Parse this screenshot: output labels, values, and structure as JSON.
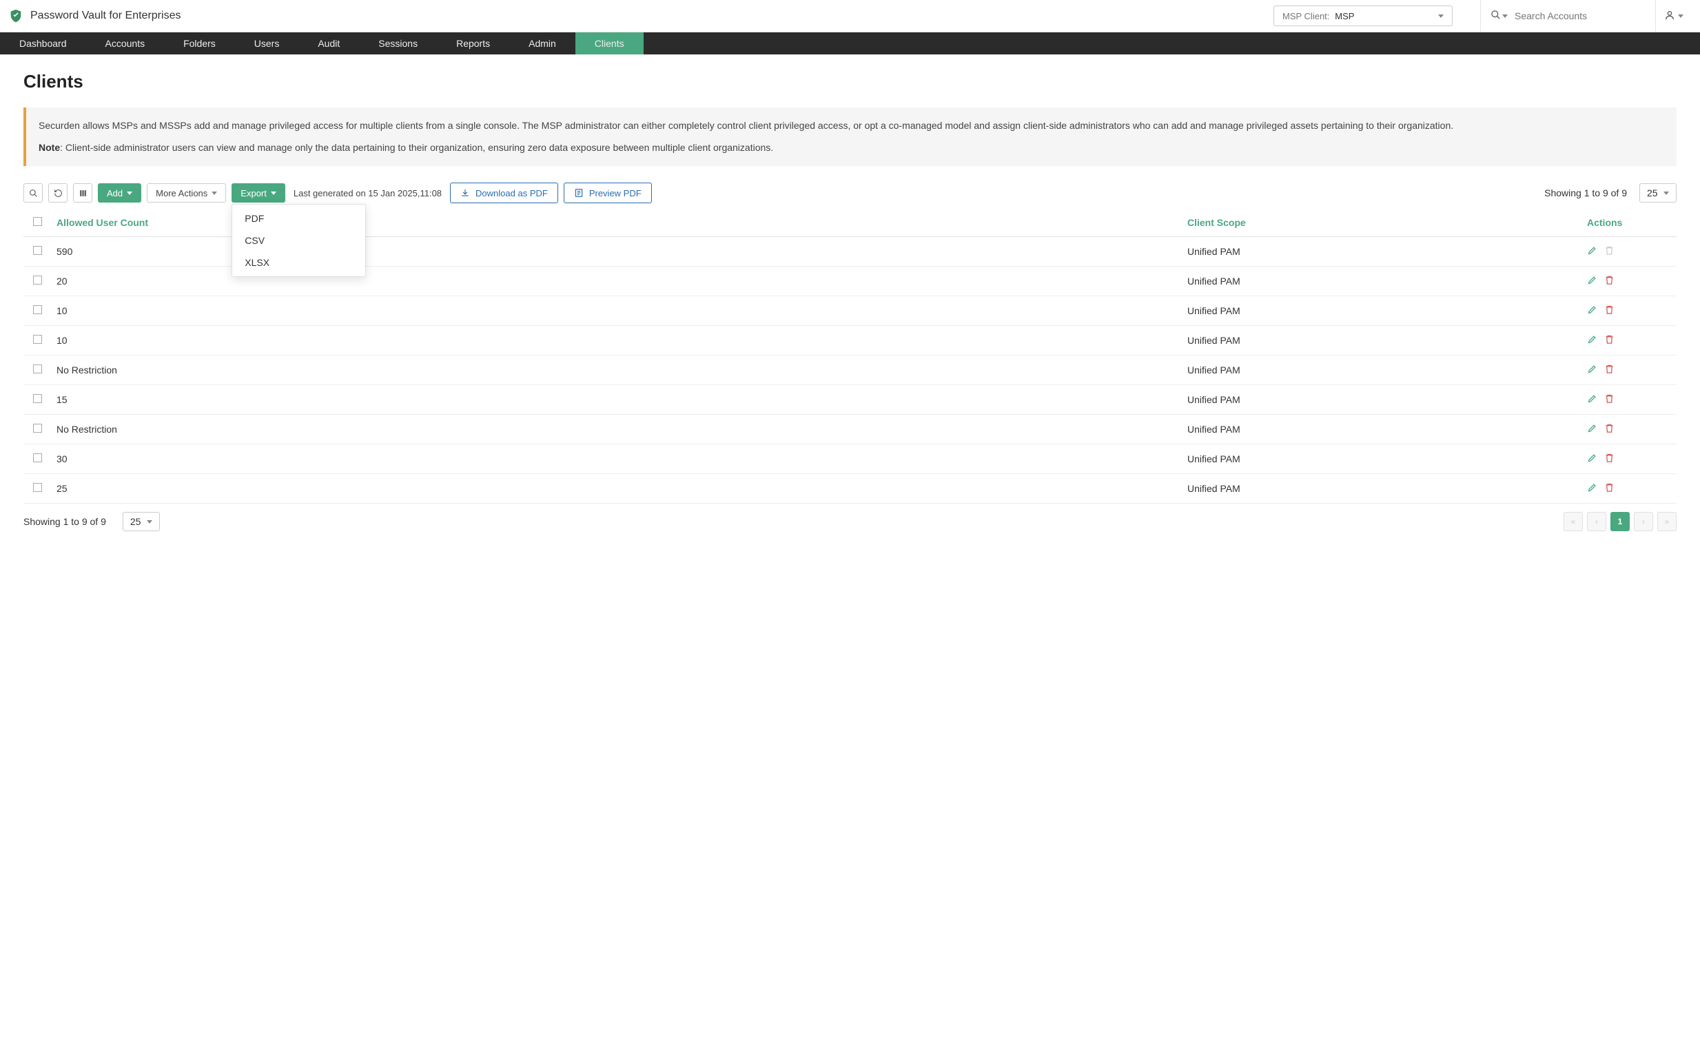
{
  "app": {
    "title": "Password Vault for Enterprises"
  },
  "msp_client": {
    "label": "MSP Client:",
    "value": "MSP"
  },
  "search": {
    "placeholder": "Search Accounts"
  },
  "nav": {
    "items": [
      "Dashboard",
      "Accounts",
      "Folders",
      "Users",
      "Audit",
      "Sessions",
      "Reports",
      "Admin",
      "Clients"
    ],
    "active": 8
  },
  "page": {
    "title": "Clients"
  },
  "info": {
    "p1": "Securden allows MSPs and MSSPs add and manage privileged access for multiple clients from a single console. The MSP administrator can either completely control client privileged access, or opt a co-managed model and assign client-side administrators who can add and manage privileged assets pertaining to their organization.",
    "note_label": "Note",
    "note_text": ": Client-side administrator users can view and manage only the data pertaining to their organization, ensuring zero data exposure between multiple client organizations."
  },
  "toolbar": {
    "add": "Add",
    "more_actions": "More Actions",
    "export": "Export",
    "export_options": [
      "PDF",
      "CSV",
      "XLSX"
    ],
    "last_generated": "Last generated on 15 Jan 2025,11:08",
    "download_pdf": "Download as PDF",
    "preview_pdf": "Preview PDF",
    "showing": "Showing 1 to 9 of 9",
    "page_size": "25"
  },
  "table": {
    "headers": {
      "count": "Allowed User Count",
      "scope": "Client Scope",
      "actions": "Actions"
    },
    "rows": [
      {
        "count": "590",
        "scope": "Unified PAM",
        "delete_enabled": false
      },
      {
        "count": "20",
        "scope": "Unified PAM",
        "delete_enabled": true
      },
      {
        "count": "10",
        "scope": "Unified PAM",
        "delete_enabled": true
      },
      {
        "count": "10",
        "scope": "Unified PAM",
        "delete_enabled": true
      },
      {
        "count": "No Restriction",
        "scope": "Unified PAM",
        "delete_enabled": true
      },
      {
        "count": "15",
        "scope": "Unified PAM",
        "delete_enabled": true
      },
      {
        "count": "No Restriction",
        "scope": "Unified PAM",
        "delete_enabled": true
      },
      {
        "count": "30",
        "scope": "Unified PAM",
        "delete_enabled": true
      },
      {
        "count": "25",
        "scope": "Unified PAM",
        "delete_enabled": true
      }
    ]
  },
  "footer": {
    "showing": "Showing 1 to 9 of 9",
    "page_size": "25",
    "current_page": "1"
  }
}
